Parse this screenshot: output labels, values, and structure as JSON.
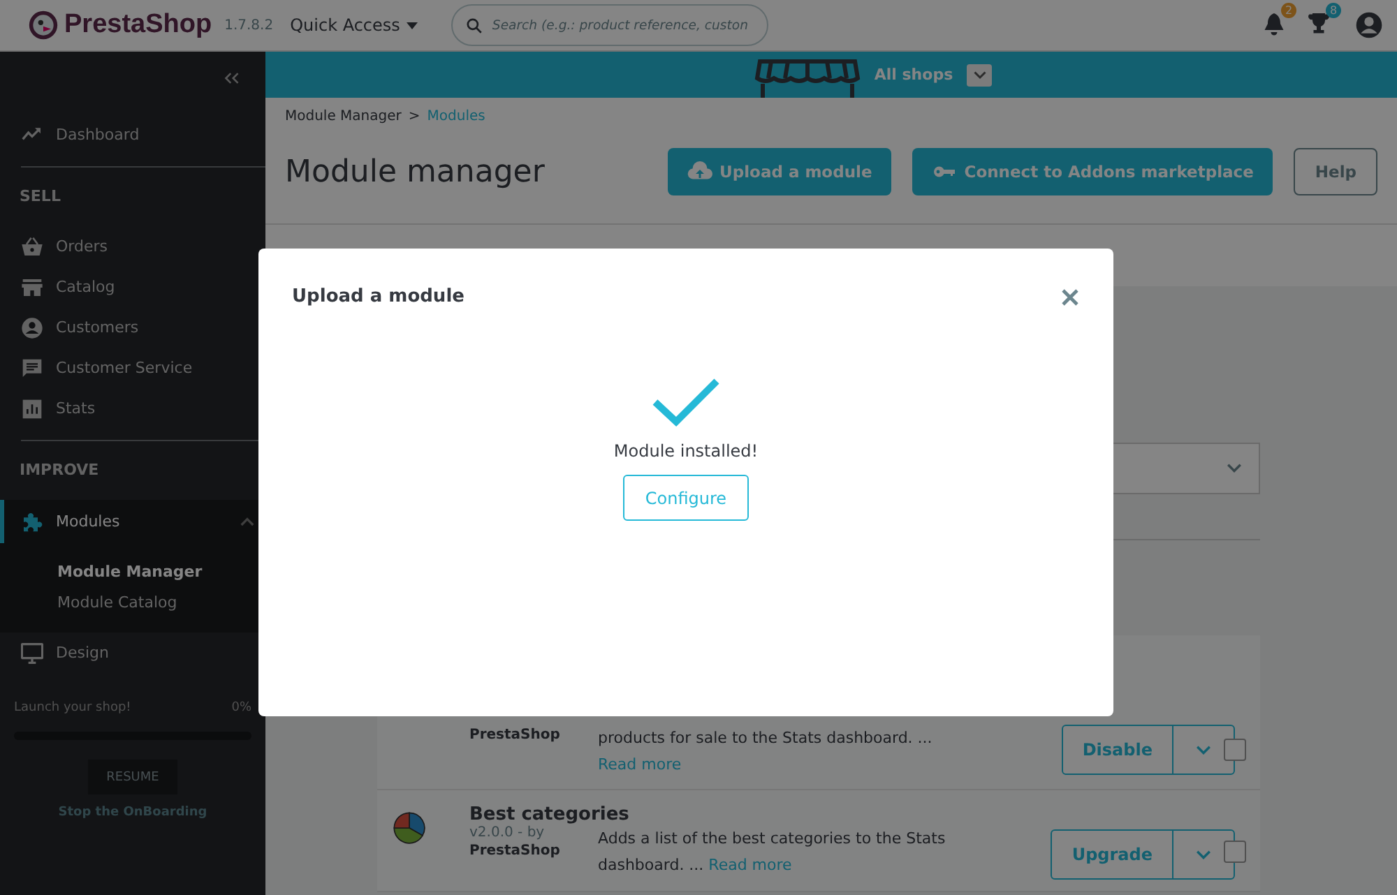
{
  "header": {
    "logo": "PrestaShop",
    "version": "1.7.8.2",
    "quick_access": "Quick Access",
    "search": {
      "placeholder": "Search (e.g.: product reference, custon"
    },
    "notifications": [
      {
        "count": "2"
      },
      {
        "count": "8"
      }
    ]
  },
  "sidebar": {
    "sections": [
      {
        "items": [
          {
            "label": "Dashboard",
            "selected": false
          }
        ]
      },
      {
        "title": "SELL",
        "items": [
          {
            "label": "Orders",
            "selected": false
          },
          {
            "label": "Catalog",
            "selected": false
          },
          {
            "label": "Customers",
            "selected": false
          },
          {
            "label": "Customer Service",
            "selected": false
          },
          {
            "label": "Stats",
            "selected": false
          }
        ]
      },
      {
        "title": "IMPROVE",
        "items": [
          {
            "label": "Modules",
            "selected": true,
            "expanded": true,
            "children": [
              {
                "label": "Module Manager",
                "selected": true
              },
              {
                "label": "Module Catalog",
                "selected": false
              }
            ]
          },
          {
            "label": "Design",
            "selected": false
          }
        ]
      }
    ],
    "onboarding": {
      "label": "Launch your shop!",
      "reading": "0%",
      "level": 0,
      "button": "RESUME",
      "link": "Stop the OnBoarding"
    }
  },
  "shop_bar": {
    "label": "All shops"
  },
  "breadcrumb": [
    {
      "kind": "link",
      "label": "Module Manager",
      "selected": false
    },
    {
      "kind": "separator",
      "label": ">"
    },
    {
      "kind": "link",
      "label": "Modules",
      "selected": true
    }
  ],
  "page_title": "Module manager",
  "toolbar": [
    {
      "label": "Upload a module",
      "kind": "primary"
    },
    {
      "label": "Connect to Addons marketplace",
      "kind": "primary"
    },
    {
      "label": "Help",
      "kind": "outline"
    }
  ],
  "modules": [
    {
      "author": "PrestaShop",
      "description": "products for sale to the Stats dashboard. ... ",
      "link": "Read more",
      "action": "Disable",
      "checked": false
    },
    {
      "name": "Best categories",
      "version": "v2.0.0 - by",
      "author": "PrestaShop",
      "description": "Adds a list of the best categories to the Stats dashboard. ... ",
      "link": "Read more",
      "action": "Upgrade",
      "checked": false
    }
  ],
  "modal": {
    "title": "Upload a module",
    "message": "Module installed!",
    "button": "Configure"
  }
}
